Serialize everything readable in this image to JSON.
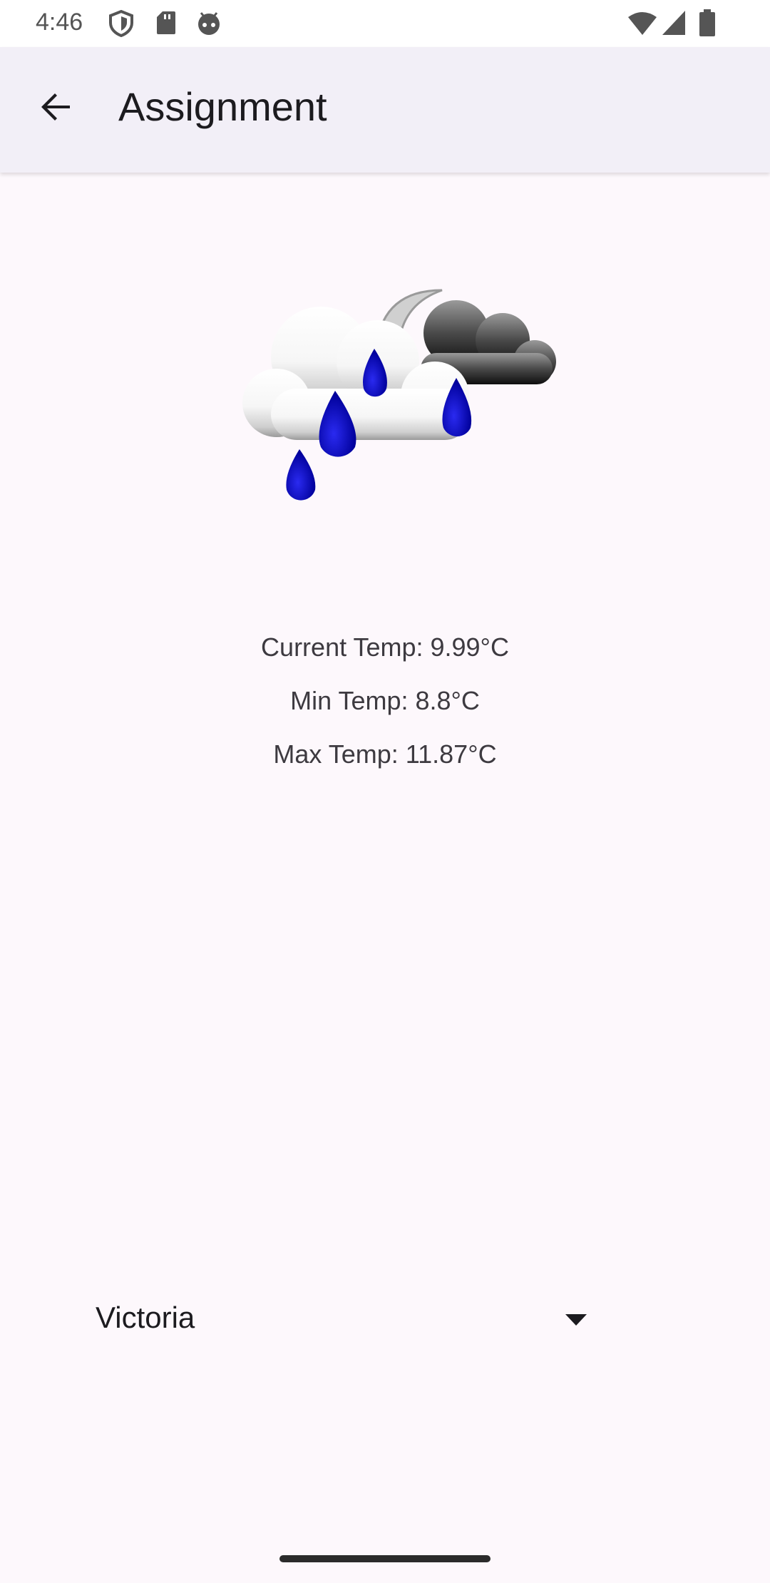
{
  "status_bar": {
    "time": "4:46",
    "icons": [
      "shield-icon",
      "sd-card-icon",
      "android-icon",
      "wifi-icon",
      "cell-signal-icon",
      "battery-icon"
    ]
  },
  "app_bar": {
    "title": "Assignment",
    "back_icon": "arrow-back-icon"
  },
  "weather": {
    "icon": "cloud-rain-night-icon",
    "current_temp": "Current Temp: 9.99°C",
    "min_temp": "Min Temp: 8.8°C",
    "max_temp": "Max Temp: 11.87°C"
  },
  "city_dropdown": {
    "selected": "Victoria",
    "arrow_icon": "dropdown-arrow-icon"
  },
  "colors": {
    "background": "#fdf8fc",
    "app_bar": "#f2eff7",
    "rain_drop": "#0a0ab8"
  }
}
